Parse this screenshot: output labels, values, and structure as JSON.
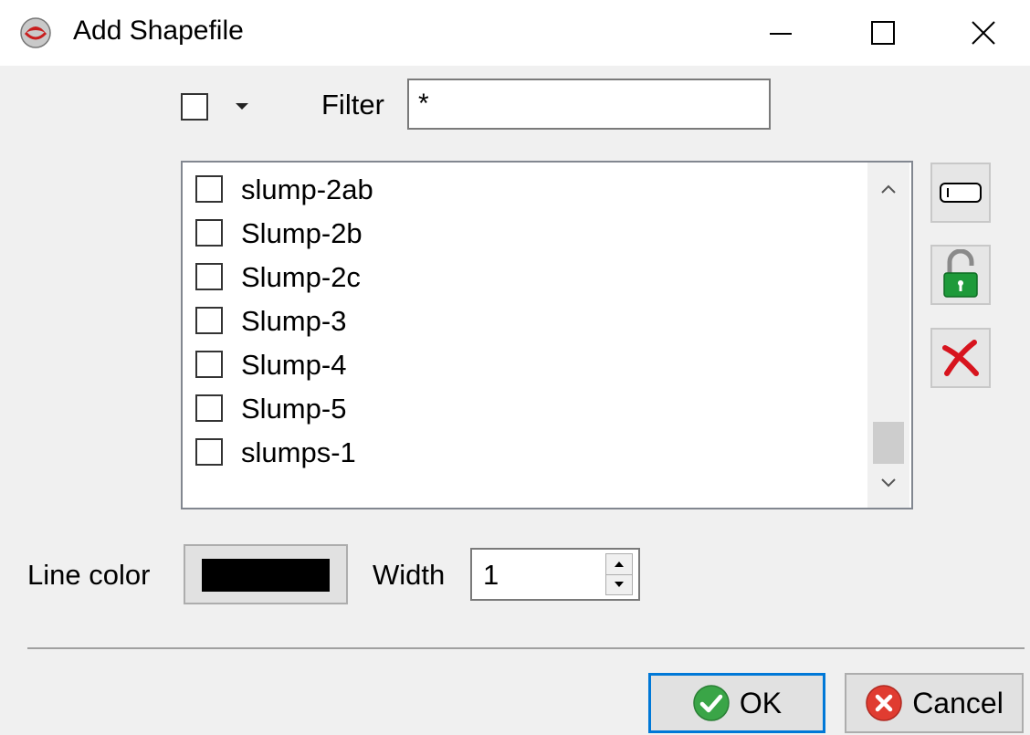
{
  "window": {
    "title": "Add Shapefile",
    "icon": "map-app-icon",
    "controls": [
      "minimize-icon",
      "maximize-icon",
      "close-icon"
    ]
  },
  "toolbar": {
    "select_all_checked": false,
    "filter_label": "Filter",
    "filter_value": "*"
  },
  "layer_list": {
    "items": [
      {
        "label": "slump-2ab",
        "checked": false
      },
      {
        "label": "Slump-2b",
        "checked": false
      },
      {
        "label": "Slump-2c",
        "checked": false
      },
      {
        "label": "Slump-3",
        "checked": false
      },
      {
        "label": "Slump-4",
        "checked": false
      },
      {
        "label": "Slump-5",
        "checked": false
      },
      {
        "label": "slumps-1",
        "checked": false
      }
    ]
  },
  "side_buttons": [
    "rename-icon",
    "unlock-icon",
    "delete-icon"
  ],
  "style": {
    "line_color_label": "Line color",
    "line_color": "#000000",
    "width_label": "Width",
    "width_value": "1"
  },
  "footer": {
    "ok_label": "OK",
    "cancel_label": "Cancel"
  },
  "colors": {
    "accent": "#0078d7",
    "ok_green": "#3aa547",
    "cancel_red": "#e03c31",
    "lock_green": "#1e9a3a",
    "delete_red": "#d7141e"
  }
}
